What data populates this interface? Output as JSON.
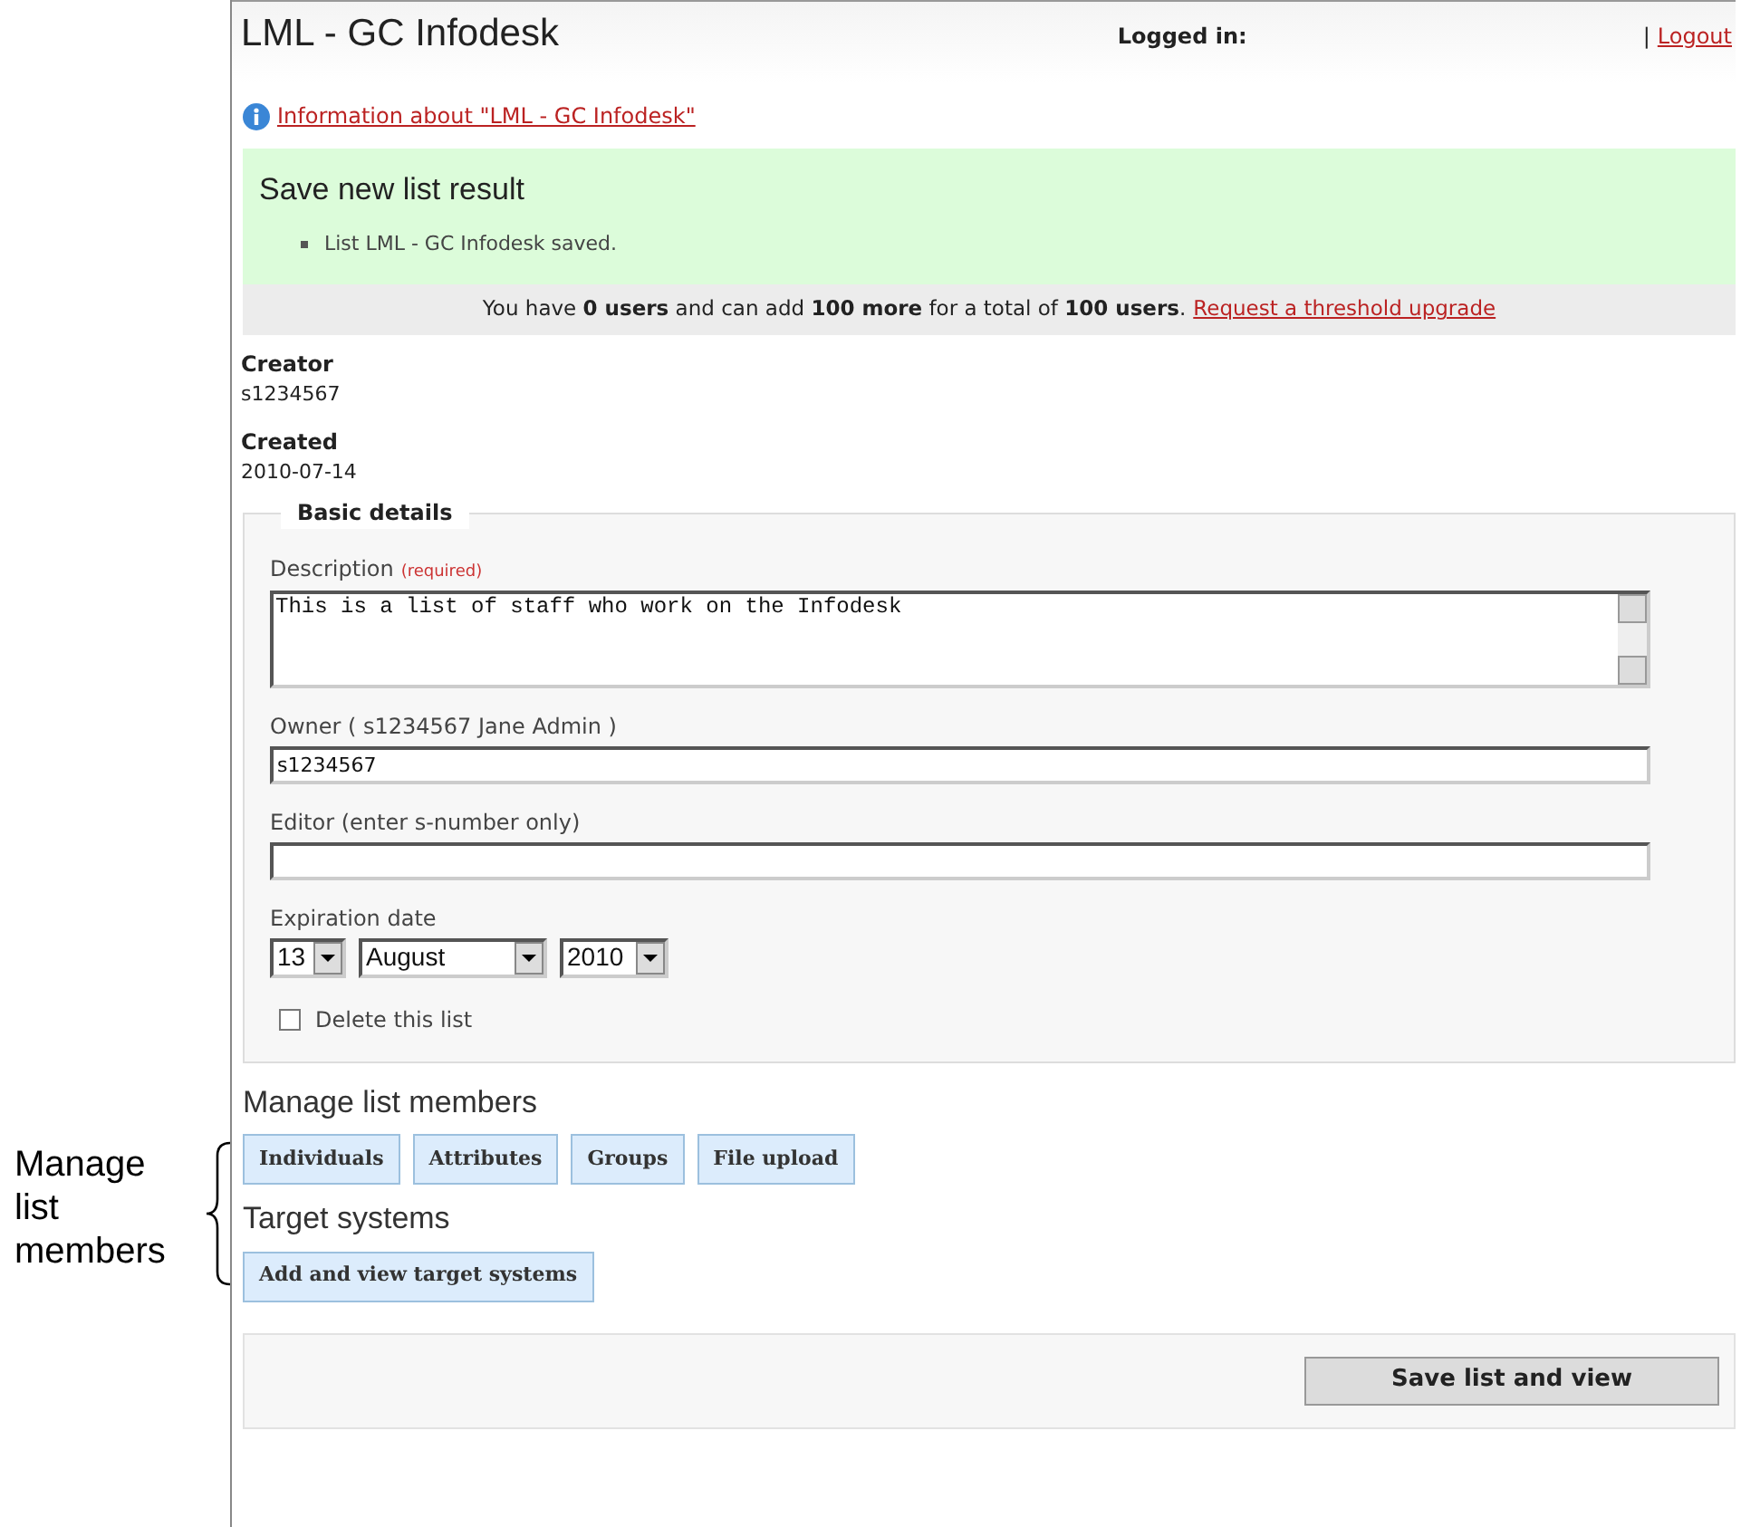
{
  "annotation": {
    "text": "Manage list members"
  },
  "header": {
    "title": "LML - GC Infodesk",
    "logged_in_label": "Logged in:",
    "separator": "|",
    "logout_link": "Logout"
  },
  "info_link": "Information about \"LML - GC Infodesk\"",
  "result": {
    "title": "Save new list result",
    "messages": [
      "List LML - GC Infodesk saved."
    ]
  },
  "quota": {
    "text": "You have **0 users** and can add **100 more** for a total of **100 users**.",
    "link": "Request a threshold upgrade"
  },
  "details": [
    {
      "label": "Creator",
      "value": "s1234567"
    },
    {
      "label": "Created",
      "value": "2010-07-14"
    }
  ],
  "basic_details": {
    "legend": "Basic details",
    "description": {
      "label": "Description",
      "note": "(required)",
      "value": "This is a list of staff who work on the Infodesk"
    },
    "owner": {
      "label": "Owner ( s1234567 Jane Admin )",
      "value": "s1234567"
    },
    "editor": {
      "label": "Editor (enter s-number only)"
    },
    "expiration": {
      "label": "Expiration date",
      "day": "13",
      "month": "August",
      "year": "2010"
    },
    "delete_list": {
      "label": "Delete this list",
      "checked": false
    }
  },
  "manage_members": {
    "heading": "Manage list members",
    "buttons": [
      "Individuals",
      "Attributes",
      "Groups",
      "File upload"
    ]
  },
  "target_systems": {
    "heading": "Target systems",
    "buttons": [
      "Add and view target systems"
    ]
  },
  "footer": {
    "button": "Save list and view"
  }
}
